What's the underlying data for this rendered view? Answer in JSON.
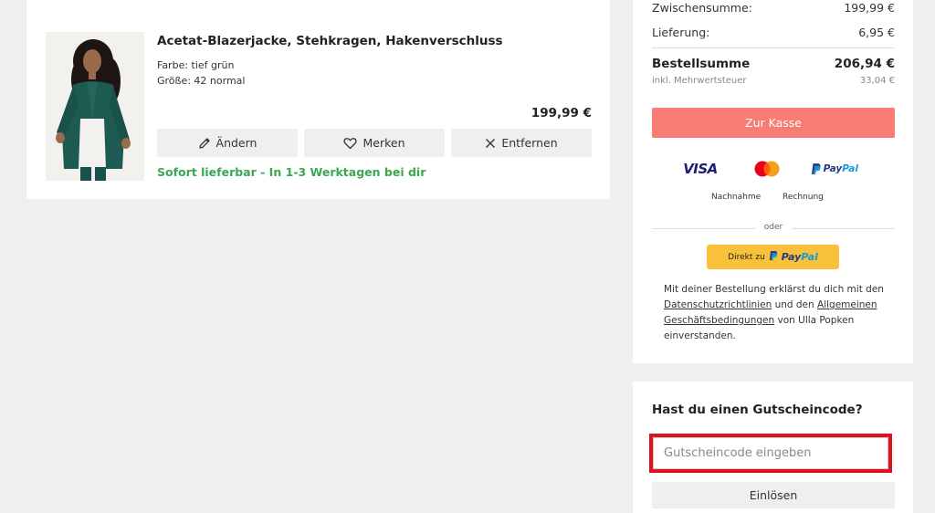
{
  "cart_item": {
    "title": "Acetat-Blazerjacke, Stehkragen, Hakenverschluss",
    "color": "Farbe: tief grün",
    "size": "Größe: 42 normal",
    "price": "199,99 €",
    "actions": {
      "edit_label": "Ändern",
      "save_label": "Merken",
      "remove_label": "Entfernen"
    },
    "delivery_note": "Sofort lieferbar - In 1-3 Werktagen bei dir"
  },
  "summary": {
    "subtotal_label": "Zwischensumme:",
    "subtotal_value": "199,99 €",
    "shipping_label": "Lieferung:",
    "shipping_value": "6,95 €",
    "total_label": "Bestellsumme",
    "total_value": "206,94 €",
    "vat_label": "inkl. Mehrwertsteuer",
    "vat_value": "33,04 €",
    "checkout_label": "Zur Kasse",
    "payment": {
      "visa": "VISA",
      "paypal_dark": "Pay",
      "paypal_light": "Pal",
      "nachnahme": "Nachnahme",
      "rechnung": "Rechnung"
    },
    "or_text": "oder",
    "paypal_direct_prefix": "Direkt zu",
    "legal": {
      "part1": "Mit deiner Bestellung erklärst du dich mit den",
      "privacy_link": "Datenschutzrichtlinien",
      "part2": "und den",
      "terms_link": "Allgemeinen Geschäftsbedingungen",
      "part3": "von Ulla Popken einverstanden."
    }
  },
  "voucher": {
    "title": "Hast du einen Gutscheincode?",
    "placeholder": "Gutscheincode eingeben",
    "redeem_label": "Einlösen"
  },
  "colors": {
    "checkout": "#f77c73",
    "delivery_green": "#3aa84f",
    "paypal_yellow": "#f7c23a",
    "highlight_red": "#e0101e"
  }
}
